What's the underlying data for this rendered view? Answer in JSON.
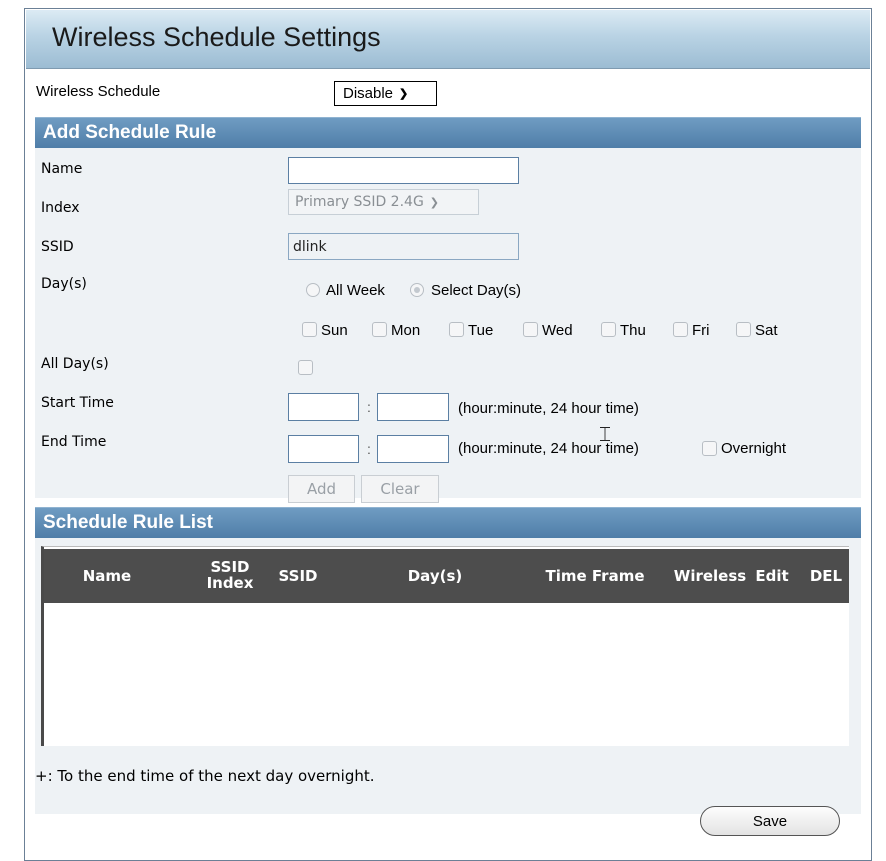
{
  "header": {
    "title": "Wireless Schedule Settings"
  },
  "wireless_schedule": {
    "label": "Wireless Schedule",
    "value": "Disable"
  },
  "add_rule": {
    "title": "Add Schedule Rule",
    "name_label": "Name",
    "name_value": "",
    "index_label": "Index",
    "index_value": "Primary SSID 2.4G",
    "ssid_label": "SSID",
    "ssid_value": "dlink",
    "days_label": "Day(s)",
    "all_week": "All Week",
    "select_days": "Select Day(s)",
    "selected_mode": "Select Day(s)",
    "weekdays": [
      "Sun",
      "Mon",
      "Tue",
      "Wed",
      "Thu",
      "Fri",
      "Sat"
    ],
    "all_days_label": "All Day(s)",
    "start_time_label": "Start Time",
    "end_time_label": "End Time",
    "time_hint": "(hour:minute, 24 hour time)",
    "colon": ":",
    "overnight": "Overnight",
    "add_button": "Add",
    "clear_button": "Clear"
  },
  "rule_list": {
    "title": "Schedule Rule List",
    "columns": [
      "Name",
      "SSID Index",
      "SSID",
      "Day(s)",
      "Time Frame",
      "Wireless",
      "Edit",
      "DEL"
    ],
    "rows": [],
    "note": "+: To the end time of the next day overnight."
  },
  "save_button": "Save",
  "colors": {
    "section_header": "#5a88b0",
    "table_header": "#4d4d4d",
    "panel_bg": "#eef2f5"
  }
}
